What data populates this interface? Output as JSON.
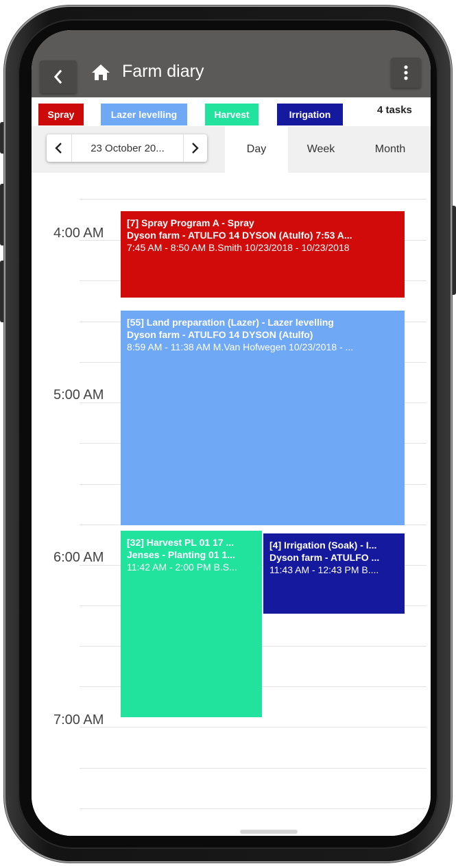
{
  "header": {
    "title": "Farm diary",
    "back_icon": "chevron-left-icon",
    "home_icon": "home-icon",
    "menu_icon": "more-vert-icon"
  },
  "legend": [
    {
      "label": "Spray",
      "color": "#cc0a0a"
    },
    {
      "label": "Lazer levelling",
      "color": "#6fa8f5"
    },
    {
      "label": "Harvest",
      "color": "#22e39d"
    },
    {
      "label": "Irrigation",
      "color": "#15199e"
    }
  ],
  "task_count": "4 tasks",
  "date_nav": {
    "date": "23 October 20...",
    "prev_icon": "chevron-left-icon",
    "next_icon": "chevron-right-icon"
  },
  "views": [
    {
      "label": "Day",
      "active": true
    },
    {
      "label": "Week",
      "active": false
    },
    {
      "label": "Month",
      "active": false
    }
  ],
  "time_labels": [
    "4:00 AM",
    "5:00 AM",
    "6:00 AM",
    "7:00 AM"
  ],
  "events": [
    {
      "title": "[7] Spray Program A - Spray",
      "location": "Dyson farm - ATULFO 14 DYSON (Atulfo) 7:53 A...",
      "details": "7:45 AM - 8:50 AM B.Smith 10/23/2018 - 10/23/2018",
      "color": "#d10a0a"
    },
    {
      "title": "[55] Land preparation (Lazer) - Lazer levelling",
      "location": "Dyson farm - ATULFO 14 DYSON (Atulfo)",
      "details": "8:59 AM - 11:38 AM M.Van Hofwegen 10/23/2018 - ...",
      "color": "#6fa8f5"
    },
    {
      "title": "[32] Harvest PL 01 17 ...",
      "location": "Jenses - Planting 01 1...",
      "details": "11:42 AM - 2:00 PM B.S...",
      "color": "#22e39d"
    },
    {
      "title": "[4] Irrigation (Soak) - I...",
      "location": "Dyson farm - ATULFO ...",
      "details": "11:43 AM - 12:43 PM B....",
      "color": "#15199e"
    }
  ]
}
